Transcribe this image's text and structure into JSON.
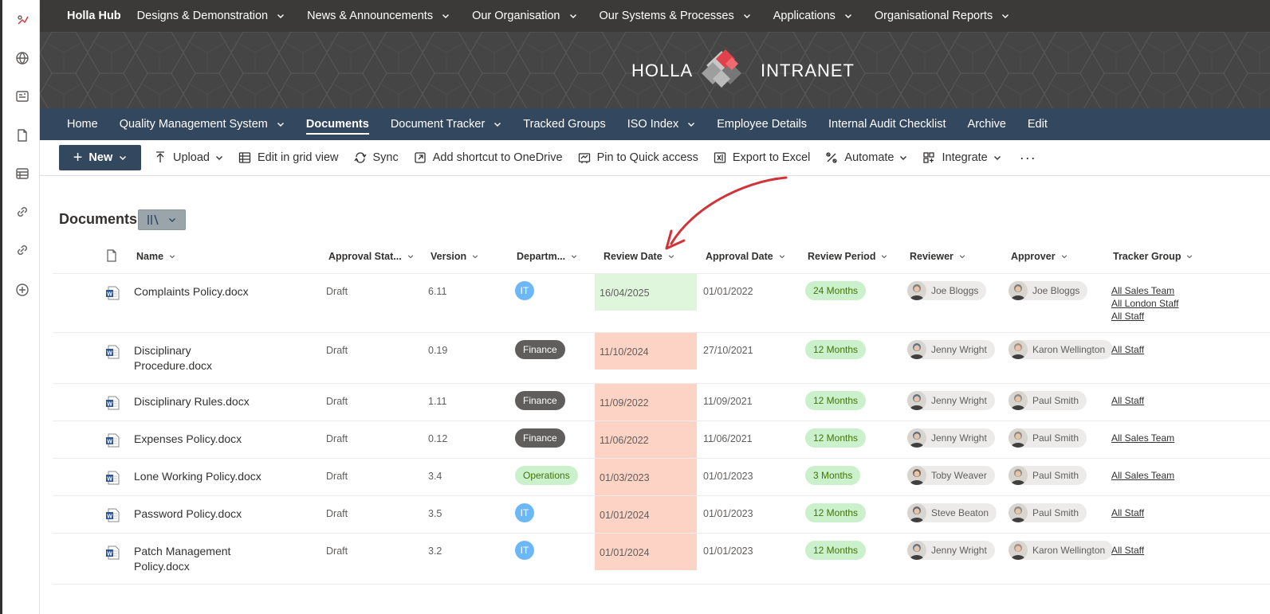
{
  "rail": {
    "icons": [
      "app-icon",
      "globe-icon",
      "news-icon",
      "file-icon",
      "list-icon",
      "link-icon",
      "link-alt-icon",
      "add-icon"
    ]
  },
  "hub": {
    "name": "Holla Hub",
    "items": [
      "Designs & Demonstration",
      "News & Announcements",
      "Our Organisation",
      "Our Systems & Processes",
      "Applications",
      "Organisational Reports"
    ]
  },
  "banner": {
    "left": "HOLLA",
    "right": "INTRANET"
  },
  "sitenav": {
    "items": [
      {
        "label": "Home",
        "dropdown": false
      },
      {
        "label": "Quality Management System",
        "dropdown": true
      },
      {
        "label": "Documents",
        "dropdown": false,
        "active": true
      },
      {
        "label": "Document Tracker",
        "dropdown": true
      },
      {
        "label": "Tracked Groups",
        "dropdown": false
      },
      {
        "label": "ISO Index",
        "dropdown": true
      },
      {
        "label": "Employee Details",
        "dropdown": false
      },
      {
        "label": "Internal Audit Checklist",
        "dropdown": false
      },
      {
        "label": "Archive",
        "dropdown": false
      },
      {
        "label": "Edit",
        "dropdown": false
      }
    ]
  },
  "cmdbar": {
    "new_label": "New",
    "commands": [
      {
        "label": "Upload",
        "icon": "upload-icon",
        "dropdown": true
      },
      {
        "label": "Edit in grid view",
        "icon": "grid-icon",
        "dropdown": false
      },
      {
        "label": "Sync",
        "icon": "sync-icon",
        "dropdown": false
      },
      {
        "label": "Add shortcut to OneDrive",
        "icon": "shortcut-icon",
        "dropdown": false
      },
      {
        "label": "Pin to Quick access",
        "icon": "pin-icon",
        "dropdown": false
      },
      {
        "label": "Export to Excel",
        "icon": "excel-icon",
        "dropdown": false
      },
      {
        "label": "Automate",
        "icon": "automate-icon",
        "dropdown": true
      },
      {
        "label": "Integrate",
        "icon": "integrate-icon",
        "dropdown": true
      }
    ],
    "more": "···"
  },
  "library": {
    "title": "Documents"
  },
  "columns": [
    "Name",
    "Approval Stat...",
    "Version",
    "Departm...",
    "Review Date",
    "Approval Date",
    "Review Period",
    "Reviewer",
    "Approver",
    "Tracker Group"
  ],
  "rows": [
    {
      "name": [
        "Complaints Policy.docx"
      ],
      "status": "Draft",
      "version": "6.11",
      "dept": "IT",
      "review": "16/04/2025",
      "review_state": "ok",
      "approval": "01/01/2022",
      "period": "24 Months",
      "reviewer": "Joe Bloggs",
      "approver": "Joe Bloggs",
      "groups": [
        "All Sales Team",
        "All London Staff",
        "All Staff"
      ]
    },
    {
      "name": [
        "Disciplinary",
        "Procedure.docx"
      ],
      "status": "Draft",
      "version": "0.19",
      "dept": "Finance",
      "review": "11/10/2024",
      "review_state": "overdue",
      "approval": "27/10/2021",
      "period": "12 Months",
      "reviewer": "Jenny Wright",
      "approver": "Karon Wellington",
      "groups": [
        "All Staff"
      ]
    },
    {
      "name": [
        "Disciplinary Rules.docx"
      ],
      "status": "Draft",
      "version": "1.11",
      "dept": "Finance",
      "review": "11/09/2022",
      "review_state": "overdue",
      "approval": "11/09/2021",
      "period": "12 Months",
      "reviewer": "Jenny Wright",
      "approver": "Paul Smith",
      "groups": [
        "All Staff"
      ]
    },
    {
      "name": [
        "Expenses Policy.docx"
      ],
      "status": "Draft",
      "version": "0.12",
      "dept": "Finance",
      "review": "11/06/2022",
      "review_state": "overdue",
      "approval": "11/06/2021",
      "period": "12 Months",
      "reviewer": "Jenny Wright",
      "approver": "Paul Smith",
      "groups": [
        "All Sales Team"
      ]
    },
    {
      "name": [
        "Lone Working Policy.docx"
      ],
      "status": "Draft",
      "version": "3.4",
      "dept": "Operations",
      "review": "01/03/2023",
      "review_state": "overdue",
      "approval": "01/01/2023",
      "period": "3 Months",
      "reviewer": "Toby Weaver",
      "approver": "Paul Smith",
      "groups": [
        "All Sales Team"
      ]
    },
    {
      "name": [
        "Password Policy.docx"
      ],
      "status": "Draft",
      "version": "3.5",
      "dept": "IT",
      "review": "01/01/2024",
      "review_state": "overdue",
      "approval": "01/01/2023",
      "period": "12 Months",
      "reviewer": "Steve Beaton",
      "approver": "Paul Smith",
      "groups": [
        "All Staff"
      ]
    },
    {
      "name": [
        "Patch Management",
        "Policy.docx"
      ],
      "status": "Draft",
      "version": "3.2",
      "dept": "IT",
      "review": "01/01/2024",
      "review_state": "overdue",
      "approval": "01/01/2023",
      "period": "12 Months",
      "reviewer": "Jenny Wright",
      "approver": "Karon Wellington",
      "groups": [
        "All Staff"
      ]
    }
  ],
  "colors": {
    "review_ok": "#dff6dd",
    "review_overdue": "#fdd3c5",
    "arrow": "#d13438",
    "nav": "#33475f"
  }
}
